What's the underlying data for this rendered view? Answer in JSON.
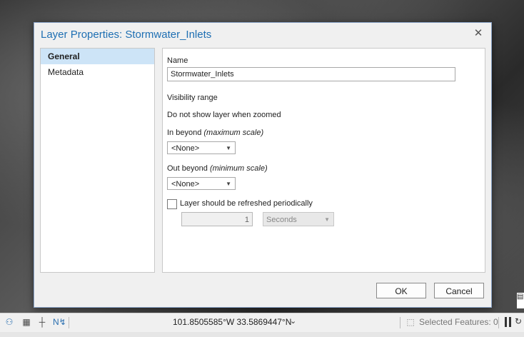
{
  "dialog": {
    "title": "Layer Properties: Stormwater_Inlets",
    "close_glyph": "✕",
    "nav": [
      {
        "label": "General",
        "selected": true
      },
      {
        "label": "Metadata",
        "selected": false
      }
    ],
    "general": {
      "name_label": "Name",
      "name_value": "Stormwater_Inlets",
      "visibility_range_label": "Visibility range",
      "do_not_show_label": "Do not show layer when zoomed",
      "in_beyond_label": "In beyond",
      "in_beyond_hint": "(maximum scale)",
      "in_beyond_value": "<None>",
      "out_beyond_label": "Out beyond",
      "out_beyond_hint": "(minimum scale)",
      "out_beyond_value": "<None>",
      "refresh_label": "Layer should be refreshed periodically",
      "refresh_checked": false,
      "refresh_interval": "1",
      "refresh_unit": "Seconds"
    },
    "ok_label": "OK",
    "cancel_label": "Cancel"
  },
  "statusbar": {
    "coordinates": "101.8505585°W 33.5869447°N",
    "selected_features": "Selected Features: 0",
    "accent": "#2a6fb0"
  }
}
